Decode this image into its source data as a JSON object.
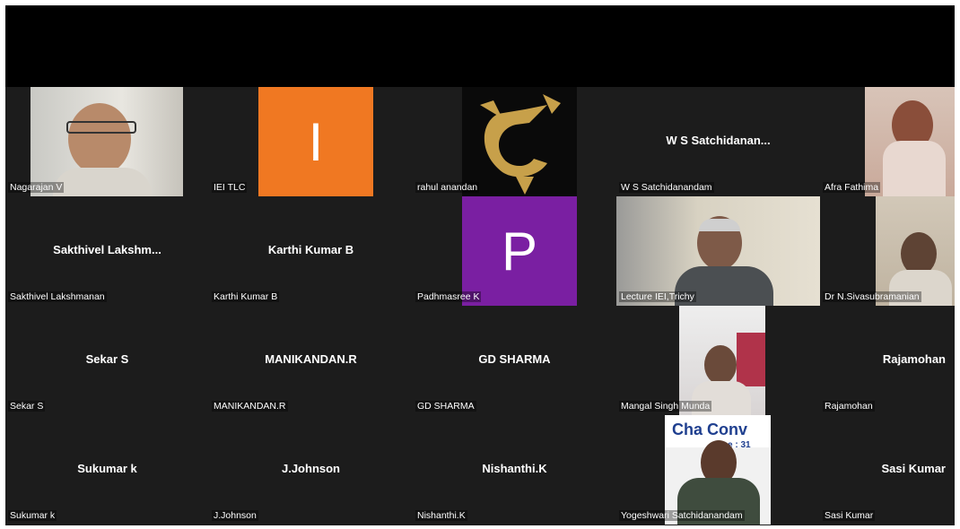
{
  "tiles": [
    {
      "label": "Nagarajan V"
    },
    {
      "label": "IEI TLC",
      "avatar_letter": "I",
      "avatar_color": "#f07822"
    },
    {
      "label": "rahul anandan"
    },
    {
      "label": "W  S Satchidanandam",
      "center": "W  S Satchidanan..."
    },
    {
      "label": "Afra Fathima"
    },
    {
      "label": "Sakthivel Lakshmanan",
      "center": "Sakthivel  Lakshm..."
    },
    {
      "label": "Karthi Kumar B",
      "center": "Karthi Kumar B"
    },
    {
      "label": "Padhmasree K",
      "avatar_letter": "P",
      "avatar_color": "#7a1fa2"
    },
    {
      "label": "Lecture IEI,Trichy"
    },
    {
      "label": "Dr N.Sivasubramanian"
    },
    {
      "label": "Sekar S",
      "center": "Sekar S"
    },
    {
      "label": "MANIKANDAN.R",
      "center": "MANIKANDAN.R"
    },
    {
      "label": "GD SHARMA",
      "center": "GD SHARMA"
    },
    {
      "label": "Mangal Singh Munda"
    },
    {
      "label": "Rajamohan",
      "center": "Rajamohan"
    },
    {
      "label": "Sukumar k",
      "center": "Sukumar k"
    },
    {
      "label": "J.Johnson",
      "center": "J.Johnson"
    },
    {
      "label": "Nishanthi.K",
      "center": "Nishanthi.K"
    },
    {
      "label": "Yogeshwari Satchidanandam",
      "banner_text": "Cha   Conv",
      "banner_sub": "e : 31"
    },
    {
      "label": "Sasi Kumar",
      "center": "Sasi Kumar"
    }
  ]
}
